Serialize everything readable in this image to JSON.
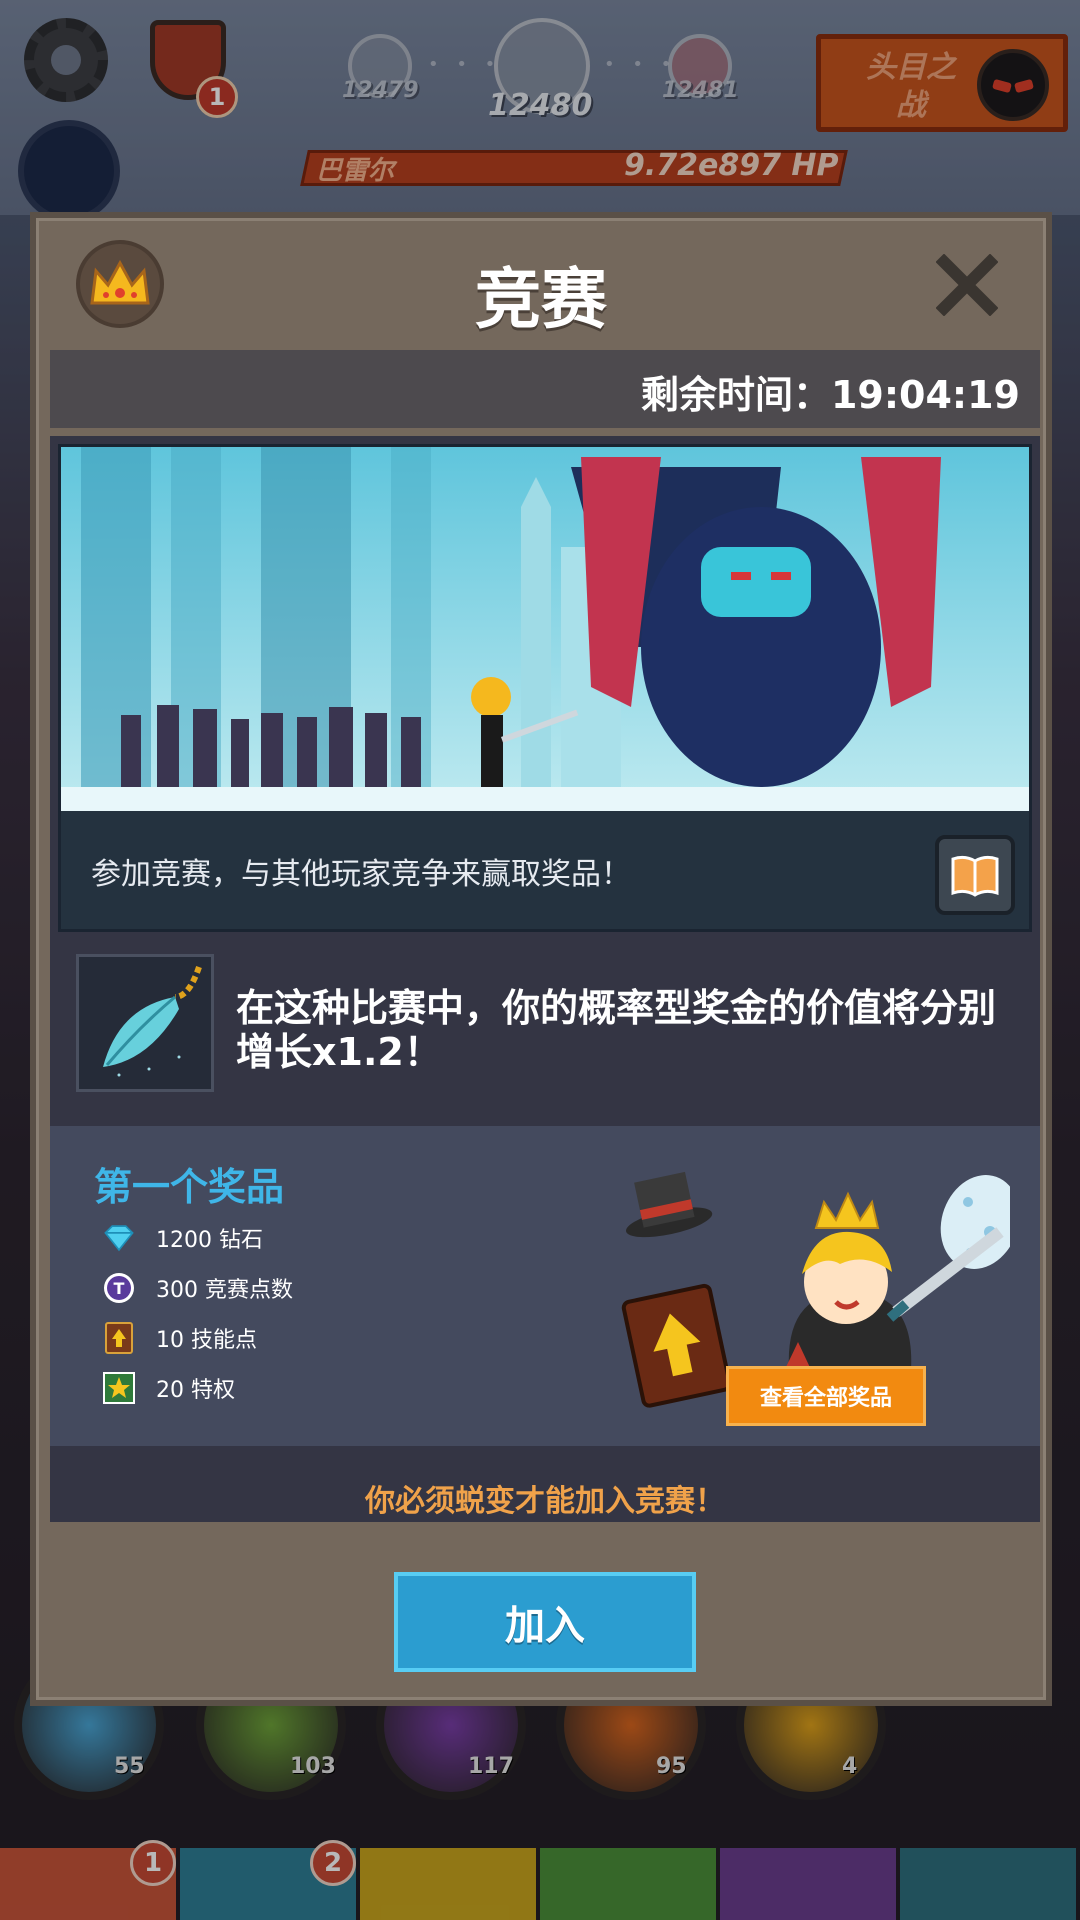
{
  "hud": {
    "clan_badge_count": "1",
    "stages": {
      "prev": "12479",
      "current": "12480",
      "next": "12481"
    },
    "boss_button_label": "头目之战",
    "boss_name": "巴雷尔",
    "boss_hp": "9.72e897 HP"
  },
  "skills": [
    {
      "level": "55",
      "color": "#4aa6d6"
    },
    {
      "level": "103",
      "color": "#6fa43a"
    },
    {
      "level": "117",
      "color": "#7a3ea8"
    },
    {
      "level": "95",
      "color": "#d9661f"
    },
    {
      "level": "4",
      "color": "#e0a21c"
    }
  ],
  "tabs": [
    {
      "color": "#c8553a",
      "badge": "1"
    },
    {
      "color": "#2f7f96",
      "badge": "2"
    },
    {
      "color": "#c9a61e",
      "badge": ""
    },
    {
      "color": "#4c8f3a",
      "badge": ""
    },
    {
      "color": "#6a3d8e",
      "badge": ""
    },
    {
      "color": "#2f6f7e",
      "badge": ""
    }
  ],
  "modal": {
    "title": "竞赛",
    "time_remaining": "剩余时间：19:04:19",
    "banner_caption": "参加竞赛，与其他玩家竞争来赢取奖品！",
    "bonus_text": "在这种比赛中，你的概率型奖金的价值将分别增长x1.2！",
    "prizes": {
      "heading": "第一个奖品",
      "items": [
        {
          "icon": "diamond-icon",
          "label": "1200 钻石"
        },
        {
          "icon": "tournament-point-icon",
          "label": "300 竞赛点数"
        },
        {
          "icon": "skill-point-icon",
          "label": "10 技能点"
        },
        {
          "icon": "perk-star-icon",
          "label": "20 特权"
        }
      ],
      "view_all_label": "查看全部奖品"
    },
    "warning": "你必须蜕变才能加入竞赛！",
    "join_label": "加入"
  },
  "colors": {
    "accent_blue": "#2b9dd0",
    "prize_heading": "#3fb6e8",
    "warning_orange": "#f0a24a",
    "view_all_orange": "#f28a10"
  }
}
